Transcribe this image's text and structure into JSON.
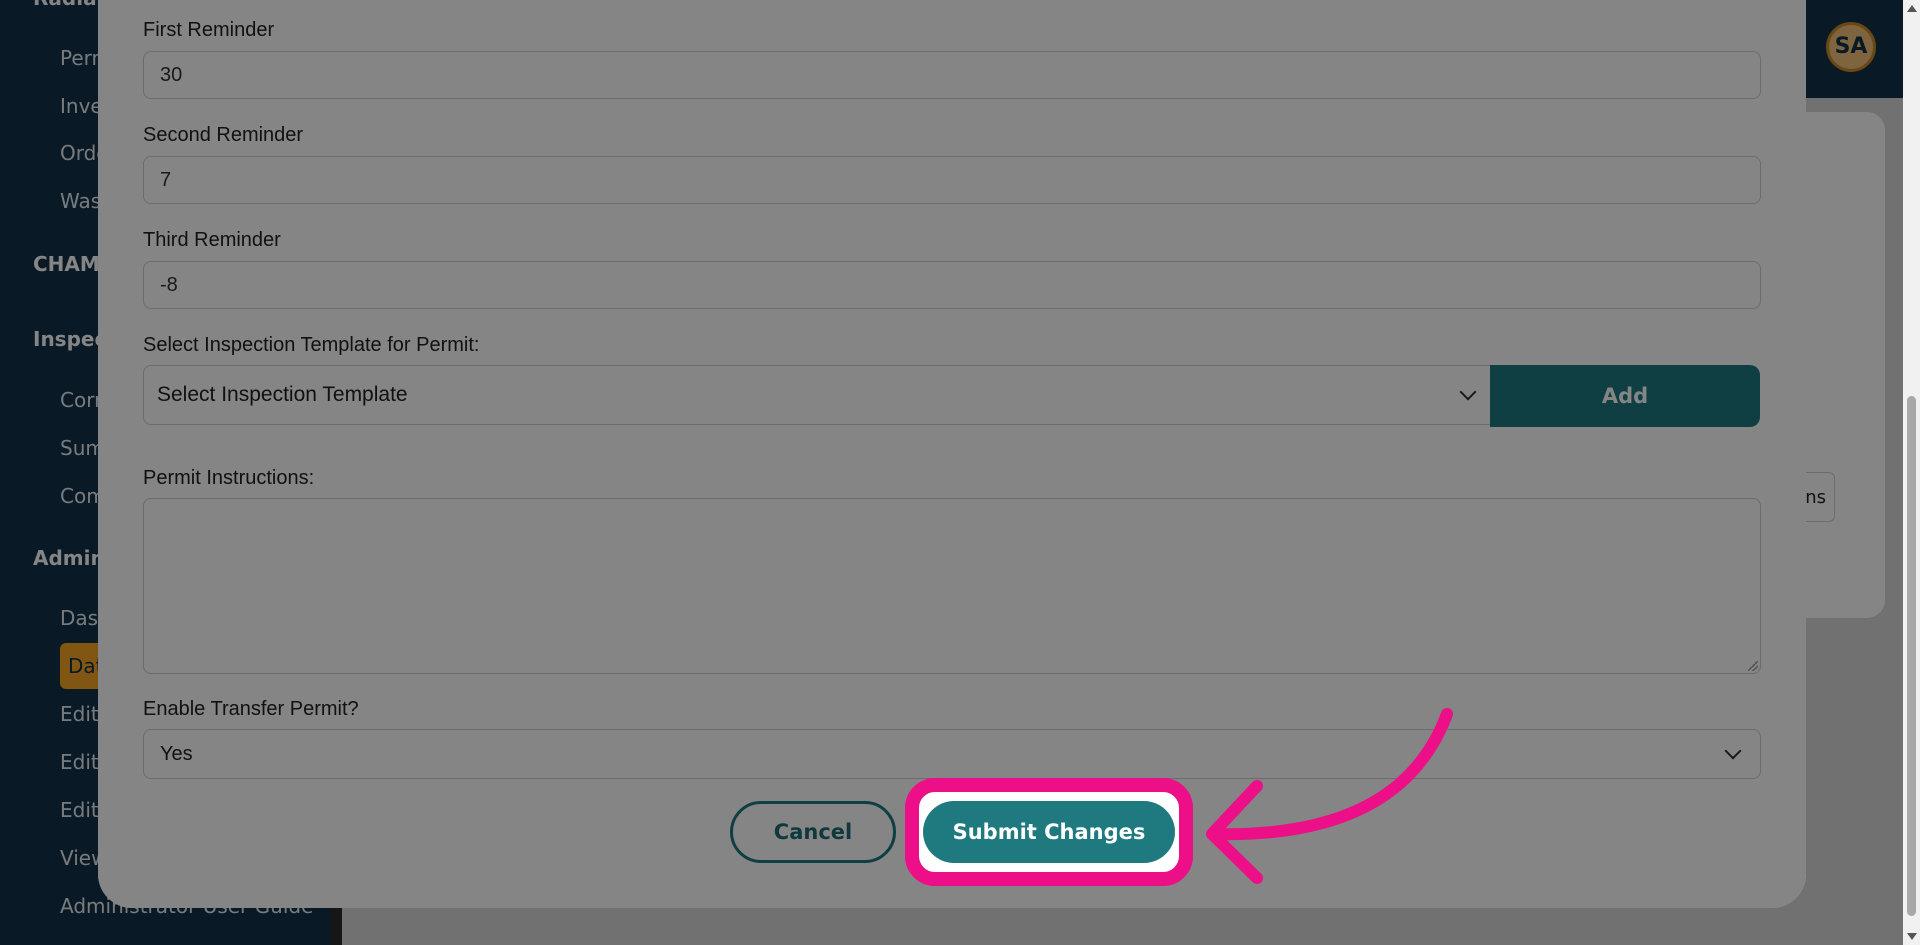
{
  "sidebar": {
    "sections": [
      "Radiation",
      "CHAMP",
      "Inspections",
      "Administration"
    ],
    "items_radiation": [
      "Permits",
      "Inventory",
      "Orders",
      "Waste"
    ],
    "items_inspections": [
      "Corrective Actions",
      "Summary",
      "Completed"
    ],
    "items_admin": [
      "Dashboard",
      "Data",
      "Edit",
      "Edit",
      "Edit",
      "View",
      "Administrator User Guide"
    ]
  },
  "header": {
    "avatar_initials": "SA"
  },
  "background": {
    "button_label_fragment": "ns"
  },
  "modal": {
    "first_reminder": {
      "label": "First Reminder",
      "value": "30"
    },
    "second_reminder": {
      "label": "Second Reminder",
      "value": "7"
    },
    "third_reminder": {
      "label": "Third Reminder",
      "value": "-8"
    },
    "inspection_template": {
      "label": "Select Inspection Template for Permit:",
      "selected": "Select Inspection Template",
      "add_label": "Add"
    },
    "instructions": {
      "label": "Permit Instructions:",
      "value": ""
    },
    "transfer": {
      "label": "Enable Transfer Permit?",
      "selected": "Yes"
    },
    "cancel_label": "Cancel",
    "submit_label": "Submit Changes"
  },
  "colors": {
    "accent": "#1e7a7f",
    "highlight": "#ec0f87",
    "sidebar_bg": "#12324a",
    "active_item": "#f5a623"
  },
  "icons": [
    "chevron-down-icon",
    "arrow-annotation-icon",
    "resize-grip-icon"
  ]
}
